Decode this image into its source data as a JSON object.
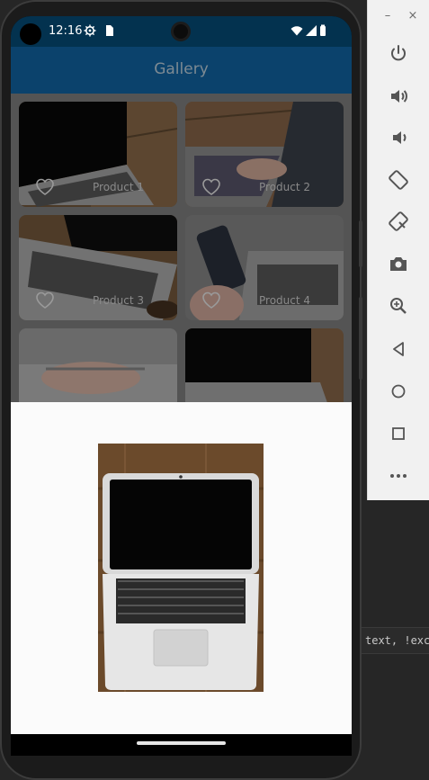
{
  "status_bar": {
    "time": "12:16",
    "icons": [
      "settings-icon",
      "sim-card-icon",
      "wifi-icon",
      "signal-icon",
      "battery-icon"
    ]
  },
  "app_bar": {
    "title": "Gallery"
  },
  "products": [
    {
      "label": "Product 1"
    },
    {
      "label": "Product 2"
    },
    {
      "label": "Product 3"
    },
    {
      "label": "Product 4"
    },
    {
      "label": ""
    },
    {
      "label": ""
    }
  ],
  "preview": {
    "description_icon": "laptop-photo"
  },
  "emulator": {
    "window_buttons": [
      "–",
      "×"
    ],
    "tools": [
      "power-icon",
      "volume-up-icon",
      "volume-down-icon",
      "rotate-left-icon",
      "rotate-right-icon",
      "screenshot-icon",
      "zoom-icon",
      "back-icon",
      "home-icon",
      "overview-icon",
      "more-icon"
    ]
  },
  "ide": {
    "snippet": "text, !exclu"
  },
  "colors": {
    "status_bar": "#03324f",
    "app_bar": "#0b426c",
    "sheet": "#fbfbfb"
  }
}
